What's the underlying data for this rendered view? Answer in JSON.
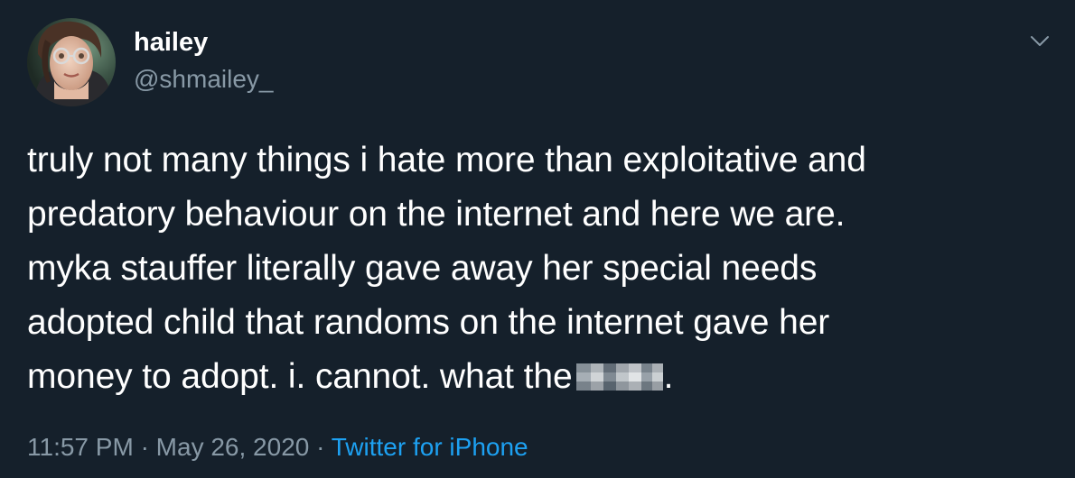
{
  "author": {
    "display_name": "hailey",
    "handle": "@shmailey_",
    "avatar_icon": "profile-photo"
  },
  "tweet": {
    "text_lines": [
      "truly not many things i hate more than exploitative and",
      "predatory behaviour on the internet and here we are.",
      "myka stauffer literally gave away her special needs",
      "adopted child that randoms on the internet gave her",
      "money to adopt. i. cannot. what the"
    ],
    "trailing_punctuation": ".",
    "censored_word_icon": "pixelated-censor-block"
  },
  "meta": {
    "time": "11:57 PM",
    "separator": "·",
    "date": "May 26, 2020",
    "source": "Twitter for iPhone"
  },
  "menu": {
    "icon": "chevron-down-icon"
  },
  "colors": {
    "background": "#15202b",
    "primary_text": "#ffffff",
    "secondary_text": "#8899a6",
    "link": "#1da1f2"
  }
}
